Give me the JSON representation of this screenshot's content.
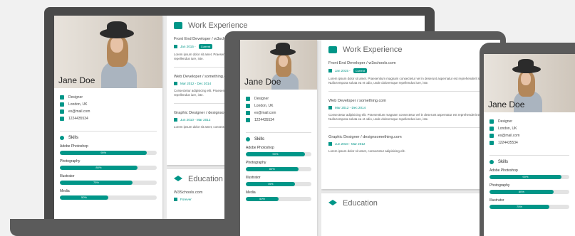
{
  "person": {
    "name": "Jane Doe",
    "title": "Designer",
    "location": "London, UK",
    "email": "ex@mail.com",
    "phone": "1224435534"
  },
  "skills_section": {
    "title": "Skills"
  },
  "skills": [
    {
      "name": "Adobe Photoshop",
      "label": "90%",
      "value": 90
    },
    {
      "name": "Photography",
      "label": "80%",
      "value": 80
    },
    {
      "name": "Illustrator",
      "label": "75%",
      "value": 75
    },
    {
      "name": "Media",
      "label": "50%",
      "value": 50
    }
  ],
  "work": {
    "title": "Work Experience",
    "jobs": [
      {
        "title": "Front End Developer / w3schools.com",
        "dates": "Jan 2015 - ",
        "badge": "Current",
        "text": "Lorem ipsum dolor sit amet. Praesentium magnam consectetur vel in deserunt aspernatur est reprehenderit sunt hic. Nulla tempora soluta ea et odio, unde doloremque repellendus iure, iste."
      },
      {
        "title": "Web Developer / something.com",
        "dates": "Mar 2012 - Dec 2014",
        "text": "Consectetur adipisicing elit. Praesentium magnam consectetur vel in deserunt aspernatur est reprehenderit sunt hic. Nulla tempora soluta ea et odio, unde doloremque repellendus iure, iste."
      },
      {
        "title": "Graphic Designer / designsomething.com",
        "dates": "Jun 2010 - Mar 2012",
        "text": "Lorem ipsum dolor sit amet, consectetur adipisicing elit."
      }
    ]
  },
  "education": {
    "title": "Education",
    "school": "W3Schools.com",
    "period": "Forever"
  },
  "colors": {
    "accent": "#009688",
    "device": "#5b5b5b",
    "background": "#f1f1f1"
  },
  "icons": [
    "briefcase-icon",
    "home-icon",
    "envelope-icon",
    "phone-icon",
    "asterisk-icon",
    "calendar-icon",
    "graduation-cap-icon"
  ]
}
